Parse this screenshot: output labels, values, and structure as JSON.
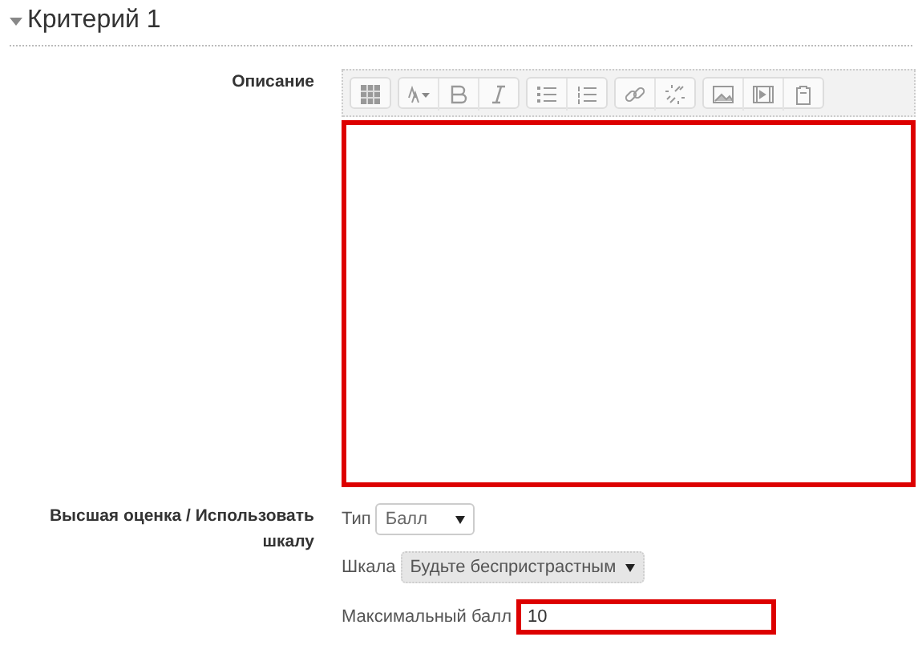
{
  "section": {
    "title": "Критерий 1",
    "expanded": true
  },
  "description": {
    "label": "Описание",
    "editor": {
      "highlighted": true
    }
  },
  "grade": {
    "label": "Высшая оценка / Использовать шкалу",
    "type": {
      "label": "Тип",
      "value": "Балл",
      "disabled": false
    },
    "scale": {
      "label": "Шкала",
      "value": "Будьте беспристрастным",
      "disabled": true
    },
    "max": {
      "label": "Максимальный балл",
      "value": "10",
      "highlighted": true
    }
  }
}
